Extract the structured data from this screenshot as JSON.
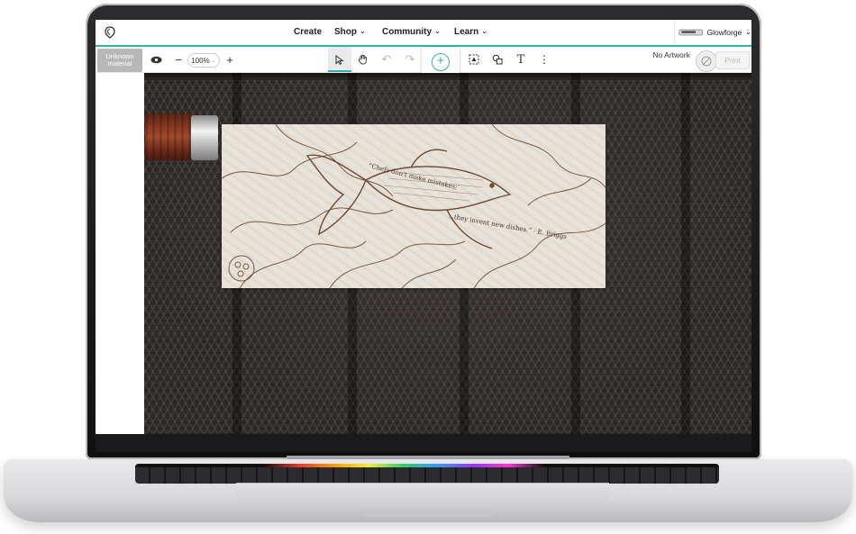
{
  "nav": {
    "items": [
      {
        "label": "Create",
        "has_dropdown": false
      },
      {
        "label": "Shop",
        "has_dropdown": true
      },
      {
        "label": "Community",
        "has_dropdown": true
      },
      {
        "label": "Learn",
        "has_dropdown": true
      }
    ],
    "account": {
      "name": "Glowforge"
    }
  },
  "toolbar": {
    "material_label": "Unknown material",
    "zoom_value": "100%",
    "no_artwork_label": "No Artwork",
    "print_label": "Print",
    "icons": [
      "eye-icon",
      "zoom-out-icon",
      "zoom-in-icon",
      "select-pointer-icon",
      "pan-hand-icon",
      "undo-icon",
      "redo-icon",
      "add-artwork-icon",
      "trace-icon",
      "shapes-icon",
      "text-icon",
      "more-options-icon"
    ]
  },
  "workspace": {
    "quote_line_1": "“Chefs don't make mistakes;",
    "quote_line_2": "...they invent new dishes.” - E. Briggs"
  },
  "colors": {
    "accent": "#2fb3ad",
    "bed": "#2d2927",
    "board": "#e7e2da"
  }
}
